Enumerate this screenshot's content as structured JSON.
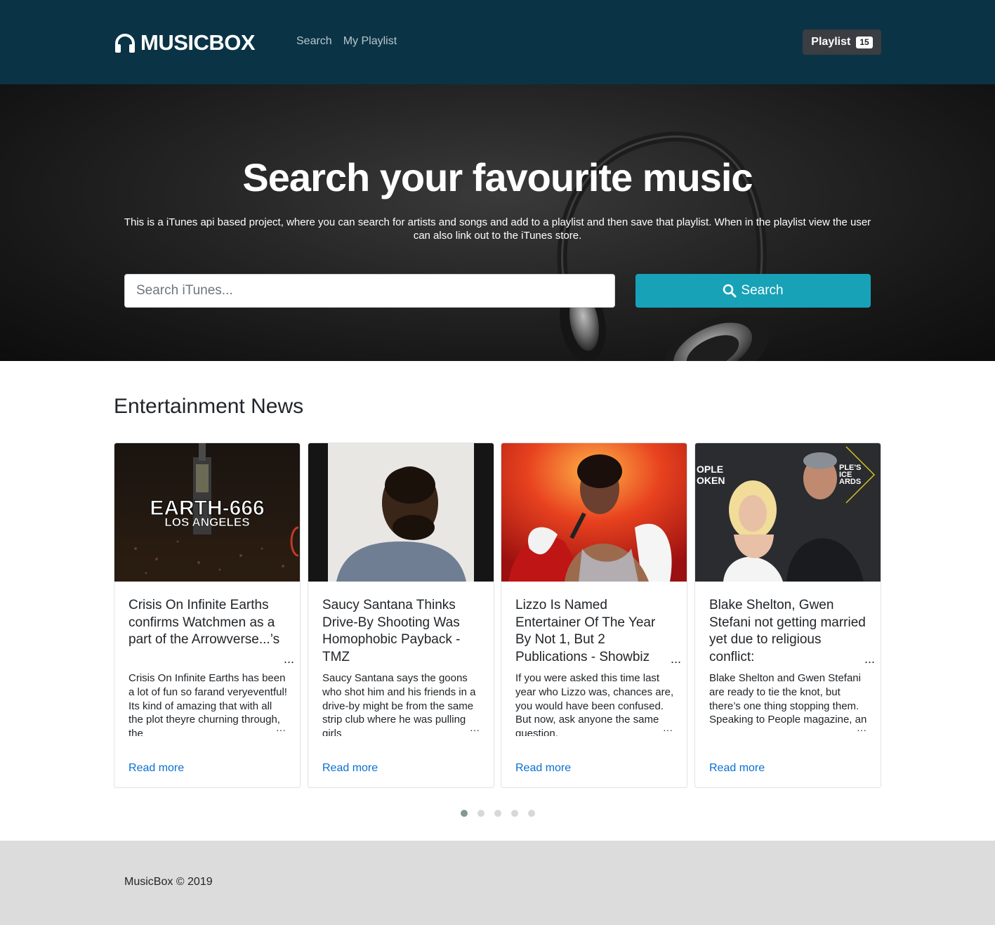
{
  "header": {
    "brand": "MUSICBOX",
    "nav": [
      {
        "label": "Search"
      },
      {
        "label": "My Playlist"
      }
    ],
    "playlist_button": {
      "label": "Playlist",
      "count": "15"
    }
  },
  "hero": {
    "title": "Search your favourite music",
    "description": "This is a iTunes api based project, where you can search for artists and songs and add to a playlist and then save that playlist. When in the playlist view the user can also link out to the iTunes store.",
    "search_placeholder": "Search iTunes...",
    "search_button": "Search"
  },
  "news": {
    "heading": "Entertainment News",
    "cards": [
      {
        "title": "Crisis On Infinite Earths confirms Watchmen as a part of the Arrowverse...’s",
        "text": "Crisis On Infinite Earths has been a lot of fun so farand veryeventful! Its kind of amazing that with all the plot theyre churning through, the",
        "read_more": "Read more",
        "image_text_1": "EARTH-666",
        "image_text_2": "LOS ANGELES"
      },
      {
        "title": "Saucy Santana Thinks Drive-By Shooting Was Homophobic Payback - TMZ",
        "text": "Saucy Santana says the goons who shot him and his friends in a drive-by might be from the same strip club where he was pulling girls",
        "read_more": "Read more"
      },
      {
        "title": "Lizzo Is Named Entertainer Of The Year By Not 1, But 2 Publications - Showbiz",
        "text": "If you were asked this time last year who Lizzo was, chances are, you would have been confused. But now, ask anyone the same question.",
        "read_more": "Read more"
      },
      {
        "title": "Blake Shelton, Gwen Stefani not getting married yet due to religious conflict:",
        "text": "Blake Shelton and Gwen Stefani are ready to tie the knot, but there’s one thing stopping them. Speaking to People magazine, an",
        "read_more": "Read more",
        "image_text_1": "OPLE",
        "image_text_2": "OKEN",
        "image_text_3": "PLE'S",
        "image_text_4": "ICE",
        "image_text_5": "ARDS"
      }
    ],
    "ellipsis": "...",
    "ellipsis_small": "···"
  },
  "footer": {
    "text": "MusicBox © 2019"
  },
  "colors": {
    "navbar": "#0a3446",
    "accent": "#17a2b8",
    "link": "#0a6fd1",
    "footer": "#dcdcdc"
  }
}
